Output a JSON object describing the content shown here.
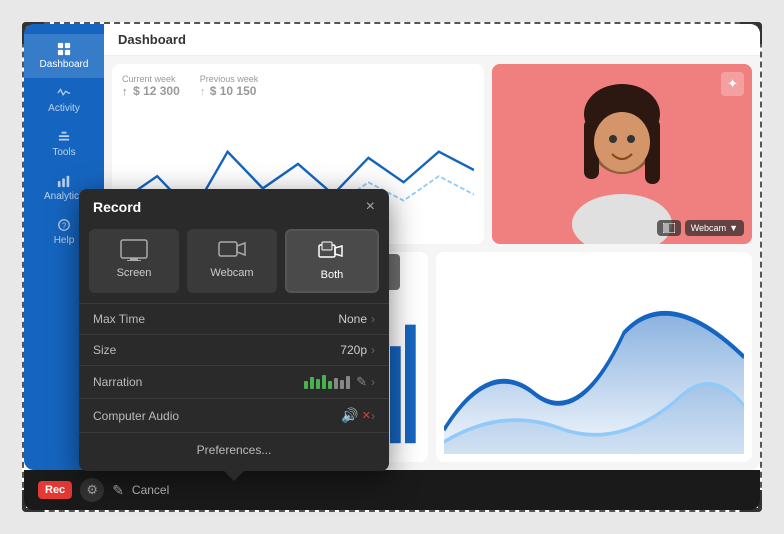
{
  "window": {
    "title": "Dashboard"
  },
  "sidebar": {
    "items": [
      {
        "label": "Dashboard",
        "icon": "home-icon",
        "active": true
      },
      {
        "label": "Activity",
        "icon": "activity-icon",
        "active": false
      },
      {
        "label": "Tools",
        "icon": "tools-icon",
        "active": false
      },
      {
        "label": "Analytics",
        "icon": "analytics-icon",
        "active": false
      },
      {
        "label": "Help",
        "icon": "help-icon",
        "active": false
      }
    ]
  },
  "dashboard": {
    "header": "Dashboard",
    "stats": {
      "current_week_label": "Current week",
      "current_week_value": "$ 12 300",
      "current_week_prefix": "↑",
      "previous_week_label": "Previous week",
      "previous_week_value": "$ 10 150",
      "previous_week_prefix": "↑"
    }
  },
  "webcam": {
    "label": "Webcam",
    "dropdown_arrow": "▼"
  },
  "record_dialog": {
    "title": "Record",
    "close": "×",
    "modes": [
      {
        "label": "Screen",
        "id": "screen",
        "active": false
      },
      {
        "label": "Webcam",
        "id": "webcam",
        "active": false
      },
      {
        "label": "Both",
        "id": "both",
        "active": true
      }
    ],
    "options": [
      {
        "label": "Max Time",
        "value": "None",
        "has_arrow": true
      },
      {
        "label": "Size",
        "value": "720p",
        "has_arrow": true
      },
      {
        "label": "Narration",
        "value": "",
        "has_levels": true,
        "has_arrow": true
      },
      {
        "label": "Computer Audio",
        "value": "",
        "has_audio": true,
        "has_arrow": true
      }
    ],
    "preferences_label": "Preferences..."
  },
  "bottom_bar": {
    "rec_label": "Rec",
    "cancel_label": "Cancel"
  }
}
